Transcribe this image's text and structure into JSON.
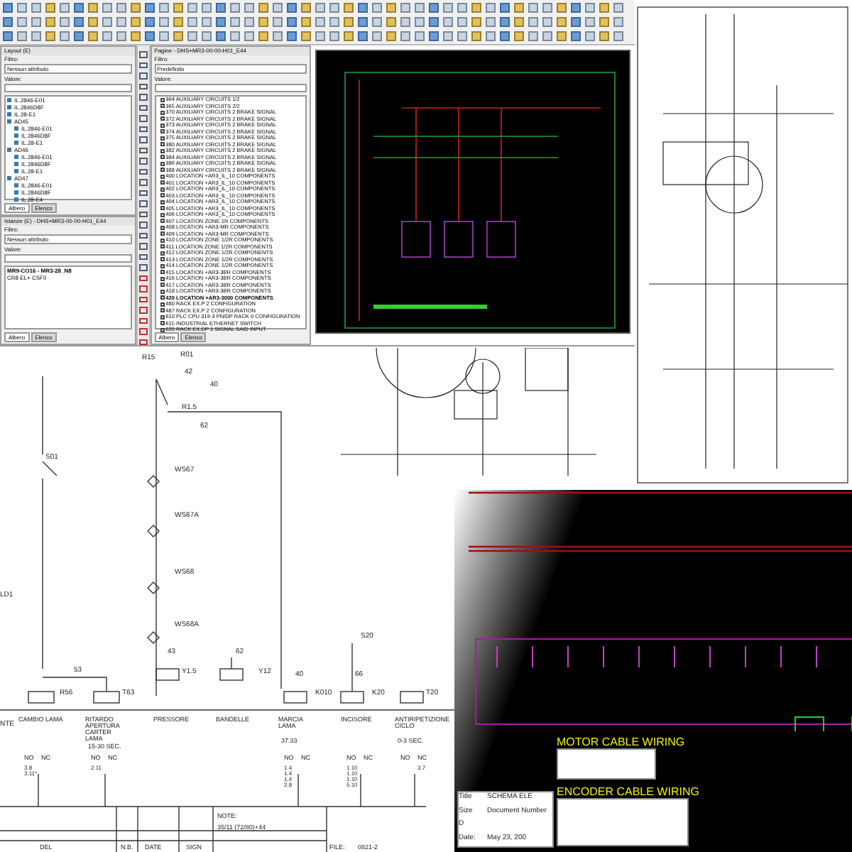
{
  "layout_panel": {
    "title": "Layout (E)",
    "filter_label": "Filtro:",
    "filter_value": "Nessun attributo",
    "value_label": "Valore:",
    "tree": [
      {
        "label": "IL.2846-E01"
      },
      {
        "label": "IL.2846D8F"
      },
      {
        "label": "IL.28-E1"
      },
      {
        "label": "AD45",
        "children": [
          {
            "label": "IL.2846-E01"
          },
          {
            "label": "IL.2846D8F"
          },
          {
            "label": "IL.28-E1"
          }
        ]
      },
      {
        "label": "AD46",
        "children": [
          {
            "label": "IL.2846-E01"
          },
          {
            "label": "IL.2846D8F"
          },
          {
            "label": "IL.28-E1"
          }
        ]
      },
      {
        "label": "AD47",
        "children": [
          {
            "label": "IL.2846-E01"
          },
          {
            "label": "IL.2846D8F"
          },
          {
            "label": "IL.28-E4"
          }
        ]
      }
    ],
    "tabs": [
      {
        "label": "Albero",
        "selected": true
      },
      {
        "label": "Elenco",
        "selected": false
      }
    ]
  },
  "instance_panel": {
    "title": "Istanze (E) - DHS+MR3-00-00-H01_E44",
    "filter_label": "Filtro:",
    "filter_value": "Nessun attributo",
    "value_label": "Valore:",
    "tree": [
      {
        "label": "MR9-CO16 - MR3-28_N8",
        "bold": true
      },
      {
        "label": "CR8 EL+ CSF0",
        "bold": false
      }
    ],
    "tabs": [
      {
        "label": "Albero",
        "selected": true
      },
      {
        "label": "Elenco",
        "selected": false
      }
    ]
  },
  "pages_panel": {
    "title": "Pagine - DHS+MR3-00-00-H01_E44",
    "filter_label": "Filtro:",
    "filter_value": "Predefinito",
    "value_label": "Valore:",
    "items": [
      {
        "label": "364 AUXILIARY CIRCUITS 1/2",
        "bold": false
      },
      {
        "label": "365 AUXILIARY CIRCUITS 2/2",
        "bold": false
      },
      {
        "label": "370 AUXILIARY CIRCUITS 2 BRAKE SIGNAL",
        "bold": false
      },
      {
        "label": "372 AUXILIARY CIRCUITS 2 BRAKE SIGNAL",
        "bold": false
      },
      {
        "label": "373 AUXILIARY CIRCUITS 2 BRAKE SIGNAL",
        "bold": false
      },
      {
        "label": "374 AUXILIARY CIRCUITS 2 BRAKE SIGNAL",
        "bold": false
      },
      {
        "label": "375 AUXILIARY CIRCUITS 2 BRAKE SIGNAL",
        "bold": false
      },
      {
        "label": "380 AUXILIARY CIRCUITS 2 BRAKE SIGNAL",
        "bold": false
      },
      {
        "label": "382 AUXILIARY CIRCUITS 2 BRAKE SIGNAL",
        "bold": false
      },
      {
        "label": "384 AUXILIARY CIRCUITS 2 BRAKE SIGNAL",
        "bold": false
      },
      {
        "label": "386 AUXILIARY CIRCUITS 2 BRAKE SIGNAL",
        "bold": false
      },
      {
        "label": "388 AUXILIARY CIRCUITS 2 BRAKE SIGNAL",
        "bold": false
      },
      {
        "label": "400 LOCATION +AR3_IL_10 COMPONENTS",
        "bold": false
      },
      {
        "label": "401 LOCATION +AR3_IL_10 COMPONENTS",
        "bold": false
      },
      {
        "label": "402 LOCATION +AR3_IL_10 COMPONENTS",
        "bold": false
      },
      {
        "label": "403 LOCATION +AR3_IL_10 COMPONENTS",
        "bold": false
      },
      {
        "label": "404 LOCATION +AR3_IL_10 COMPONENTS",
        "bold": false
      },
      {
        "label": "405 LOCATION +AR3_IL_10 COMPONENTS",
        "bold": false
      },
      {
        "label": "406 LOCATION +AR3_IL_10 COMPONENTS",
        "bold": false
      },
      {
        "label": "407 LOCATION ZONE 1R COMPONENTS",
        "bold": false
      },
      {
        "label": "408 LOCATION +AR3-MR COMPONENTS",
        "bold": false
      },
      {
        "label": "409 LOCATION +AR3-MR COMPONENTS",
        "bold": false
      },
      {
        "label": "410 LOCATION ZONE 1/2R COMPONENTS",
        "bold": false
      },
      {
        "label": "411 LOCATION ZONE 1/2R COMPONENTS",
        "bold": false
      },
      {
        "label": "412 LOCATION ZONE 1/2R COMPONENTS",
        "bold": false
      },
      {
        "label": "413 LOCATION ZONE 1/2R COMPONENTS",
        "bold": false
      },
      {
        "label": "414 LOCATION ZONE 1/2R COMPONENTS",
        "bold": false
      },
      {
        "label": "415 LOCATION +AR3-3BR COMPONENTS",
        "bold": false
      },
      {
        "label": "416 LOCATION +AR3-3BR COMPONENTS",
        "bold": false
      },
      {
        "label": "417 LOCATION +AR3-3BR COMPONENTS",
        "bold": false
      },
      {
        "label": "418 LOCATION +AR3-3BR COMPONENTS",
        "bold": false
      },
      {
        "label": "420 LOCATION +AR3-3000 COMPONENTS",
        "bold": true
      },
      {
        "label": "480 RACK EX.P 2 CONFIGURATION",
        "bold": false
      },
      {
        "label": "487 RACK EX.P 2 CONFIGURATION",
        "bold": false
      },
      {
        "label": "610 PLC CPU 319-3 PN/DP RACK 0 CONFIGURATION",
        "bold": false
      },
      {
        "label": "615 INDUSTRIAL ETHERNET SWITCH",
        "bold": false
      },
      {
        "label": "620 RACK EX.DP 1 SIGNAL SAID INPUT",
        "bold": false
      }
    ],
    "tabs": [
      {
        "label": "Albero",
        "selected": true
      },
      {
        "label": "Elenco",
        "selected": false
      }
    ]
  },
  "schematic": {
    "labels": [
      "R15",
      "R01",
      "42",
      "40",
      "R1.5",
      "62",
      "S01",
      "WS67",
      "WS67A",
      "WS68",
      "LD1",
      "WS68A",
      "S20",
      "43",
      "62",
      "53",
      "Y1.5",
      "Y12",
      "40",
      "66",
      "R56",
      "T63",
      "K010",
      "K20",
      "T20",
      "NTE"
    ],
    "functions": [
      {
        "name": "CAMBIO LAMA",
        "headers": [
          "NO",
          "NC"
        ],
        "no": "3.8\n3.11*"
      },
      {
        "name": "RITARDO\nAPERTURA\nCARTER\nLAMA",
        "timing": "15-30 SEC.",
        "headers": [
          "NO",
          "NC"
        ],
        "no": "2.11"
      },
      {
        "name": "PRESSORE"
      },
      {
        "name": "BANDELLE"
      },
      {
        "name": "MARCIA\nLAMA",
        "timing": "37.33",
        "headers": [
          "NO",
          "NC"
        ],
        "no": "1.4\n1.4\n1.4\n2.8"
      },
      {
        "name": "INCISORE",
        "headers": [
          "NO",
          "NC"
        ],
        "no": "1.10\n1.10\n1.10\n5.10"
      },
      {
        "name": "ANTIRIPETIZIONE\nCICLO",
        "timing": "0-3 SEC.",
        "headers": [
          "NO",
          "NC"
        ],
        "nc": "3.7"
      }
    ],
    "title_block": {
      "note_label": "NOTE:",
      "note": "35/11 (72/80)+44",
      "columns": [
        "DEL",
        "N.B.",
        "DATE",
        "SIGN"
      ],
      "file_label": "FILE:",
      "file": "0821-2"
    }
  },
  "control_panel": {
    "motor_title": "MOTOR CABLE WIRING",
    "encoder_title": "ENCODER CABLE WIRING",
    "title_block": {
      "title_label": "Title",
      "title": "SCHEMA ELE",
      "size_label": "Size",
      "size": "D",
      "doc_label": "Document Number",
      "date_label": "Date:",
      "date": "May 23, 200"
    }
  }
}
